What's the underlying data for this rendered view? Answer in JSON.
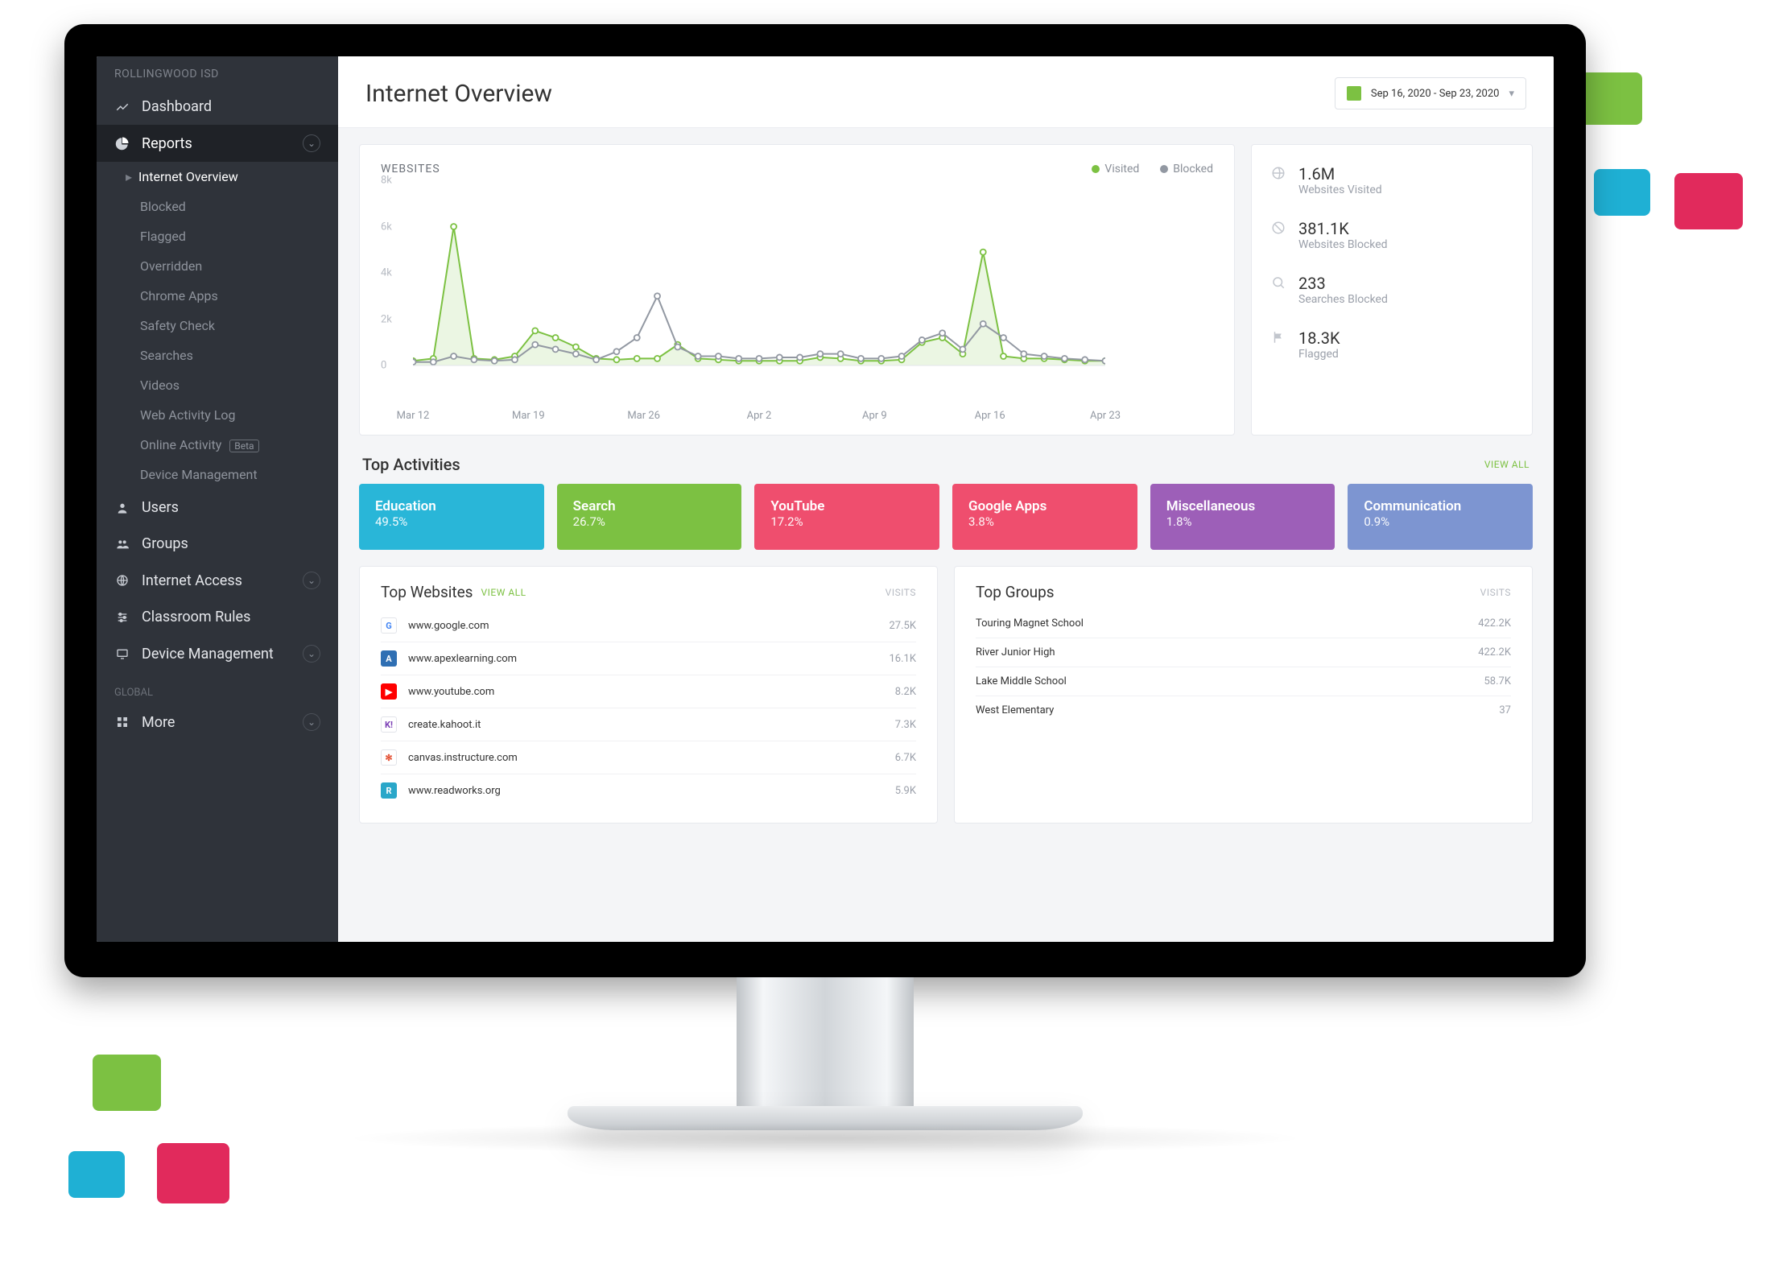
{
  "org_name": "ROLLINGWOOD ISD",
  "sidebar": {
    "dashboard": "Dashboard",
    "reports": "Reports",
    "subs": [
      "Internet Overview",
      "Blocked",
      "Flagged",
      "Overridden",
      "Chrome Apps",
      "Safety Check",
      "Searches",
      "Videos",
      "Web Activity Log",
      "Online Activity",
      "Device Management"
    ],
    "beta_badge": "Beta",
    "users": "Users",
    "groups": "Groups",
    "internet_access": "Internet Access",
    "classroom_rules": "Classroom Rules",
    "device_management": "Device Management",
    "global_label": "GLOBAL",
    "more": "More"
  },
  "page_title": "Internet Overview",
  "date_range": "Sep 16, 2020 - Sep 23, 2020",
  "chart_title": "WEBSITES",
  "legend_visited": "Visited",
  "legend_blocked": "Blocked",
  "chart_data": {
    "type": "line",
    "xlabel": "",
    "ylabel": "",
    "ylim": [
      0,
      8000
    ],
    "yticks": [
      "0",
      "2k",
      "4k",
      "6k",
      "8k"
    ],
    "categories": [
      "Mar 12",
      "Mar 19",
      "Mar 26",
      "Apr 2",
      "Apr 9",
      "Apr 16",
      "Apr 23"
    ],
    "series": [
      {
        "name": "Visited",
        "color": "#7cc142",
        "values": [
          200,
          300,
          6000,
          300,
          250,
          400,
          1500,
          1200,
          800,
          300,
          250,
          300,
          300,
          900,
          300,
          250,
          200,
          200,
          200,
          200,
          350,
          300,
          200,
          200,
          250,
          1000,
          1200,
          500,
          4900,
          400,
          300,
          300,
          250,
          200,
          200
        ]
      },
      {
        "name": "Blocked",
        "color": "#9298a2",
        "values": [
          150,
          150,
          400,
          250,
          200,
          250,
          900,
          700,
          500,
          250,
          600,
          1200,
          3000,
          800,
          400,
          400,
          300,
          300,
          350,
          350,
          500,
          500,
          300,
          300,
          400,
          1100,
          1400,
          700,
          1800,
          1200,
          500,
          400,
          300,
          250,
          200
        ]
      }
    ]
  },
  "stats": [
    {
      "value": "1.6M",
      "label": "Websites Visited",
      "icon": "globe"
    },
    {
      "value": "381.1K",
      "label": "Websites Blocked",
      "icon": "block"
    },
    {
      "value": "233",
      "label": "Searches Blocked",
      "icon": "search"
    },
    {
      "value": "18.3K",
      "label": "Flagged",
      "icon": "flag"
    }
  ],
  "top_activities_title": "Top Activities",
  "view_all": "VIEW ALL",
  "activities": [
    {
      "label": "Education",
      "pct": "49.5%",
      "color": "#29b6d8"
    },
    {
      "label": "Search",
      "pct": "26.7%",
      "color": "#7cc142"
    },
    {
      "label": "YouTube",
      "pct": "17.2%",
      "color": "#ef4e6e"
    },
    {
      "label": "Google Apps",
      "pct": "3.8%",
      "color": "#ef4e6e"
    },
    {
      "label": "Miscellaneous",
      "pct": "1.8%",
      "color": "#9d5fb8"
    },
    {
      "label": "Communication",
      "pct": "0.9%",
      "color": "#7d95d1"
    }
  ],
  "top_websites_title": "Top Websites",
  "visits_label": "VISITS",
  "websites": [
    {
      "host": "www.google.com",
      "visits": "27.5K",
      "fav": "G",
      "favbg": "#fff",
      "favfg": "#4285F4",
      "border": "#e2e4e9"
    },
    {
      "host": "www.apexlearning.com",
      "visits": "16.1K",
      "fav": "A",
      "favbg": "#2f6fb3",
      "favfg": "#fff"
    },
    {
      "host": "www.youtube.com",
      "visits": "8.2K",
      "fav": "▶",
      "favbg": "#ff0000",
      "favfg": "#fff"
    },
    {
      "host": "create.kahoot.it",
      "visits": "7.3K",
      "fav": "K!",
      "favbg": "#fff",
      "favfg": "#7b3fb5",
      "border": "#e2e4e9"
    },
    {
      "host": "canvas.instructure.com",
      "visits": "6.7K",
      "fav": "✻",
      "favbg": "#fff",
      "favfg": "#e34f32",
      "border": "#e2e4e9"
    },
    {
      "host": "www.readworks.org",
      "visits": "5.9K",
      "fav": "R",
      "favbg": "#2aa7c9",
      "favfg": "#fff"
    }
  ],
  "top_groups_title": "Top Groups",
  "groups": [
    {
      "name": "Touring Magnet School",
      "visits": "422.2K"
    },
    {
      "name": "River Junior High",
      "visits": "422.2K"
    },
    {
      "name": "Lake Middle School",
      "visits": "58.7K"
    },
    {
      "name": "West Elementary",
      "visits": "37"
    }
  ]
}
